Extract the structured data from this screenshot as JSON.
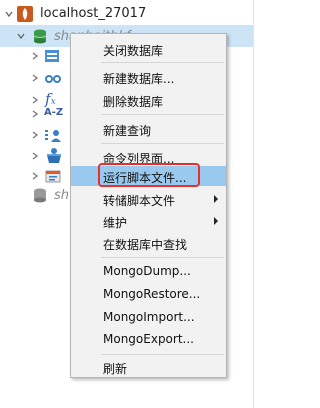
{
  "tree": {
    "connection": {
      "label": "localhost_27017",
      "icon": "mongodb-leaf-icon"
    },
    "database": {
      "label": "shanhaithkf",
      "icon": "database-icon"
    },
    "other_db_prefix": "sh",
    "children": [
      {
        "name": "collections",
        "icon": "collection-icon"
      },
      {
        "name": "views",
        "icon": "view-icon"
      },
      {
        "name": "functions",
        "icon": "function-icon"
      },
      {
        "name": "indexes",
        "icon": "a-z-icon"
      },
      {
        "name": "users",
        "icon": "users-icon"
      },
      {
        "name": "gridfs",
        "icon": "bucket-icon"
      },
      {
        "name": "queries",
        "icon": "query-icon"
      }
    ]
  },
  "menu": {
    "items": [
      {
        "label": "关闭数据库"
      },
      {
        "label": "新建数据库..."
      },
      {
        "label": "删除数据库"
      },
      {
        "label": "新建查询"
      },
      {
        "label": "命令列界面..."
      },
      {
        "label": "运行脚本文件..."
      },
      {
        "label": "转储脚本文件"
      },
      {
        "label": "维护"
      },
      {
        "label": "在数据库中查找"
      },
      {
        "label": "MongoDump..."
      },
      {
        "label": "MongoRestore..."
      },
      {
        "label": "MongoImport..."
      },
      {
        "label": "MongoExport..."
      },
      {
        "label": "刷新"
      }
    ]
  },
  "colors": {
    "highlight": "#99c9ef",
    "selection": "#cde4f7",
    "annotation": "#e5302c"
  }
}
